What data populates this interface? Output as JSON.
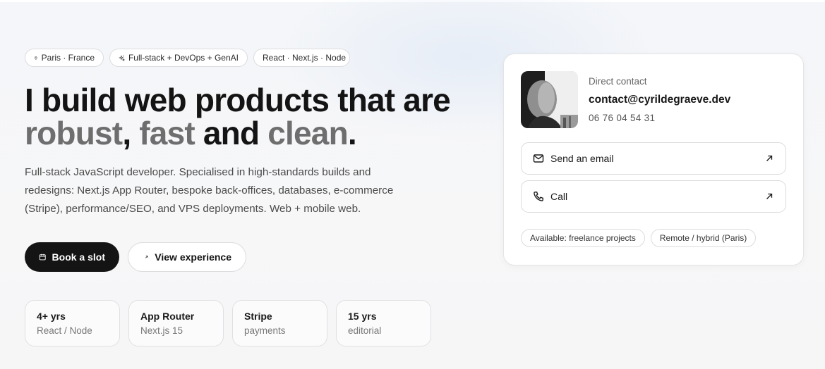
{
  "tags": [
    {
      "icon": "location-pin-icon",
      "label": "Paris · France"
    },
    {
      "icon": "sparkles-icon",
      "label": "Full-stack + DevOps + GenAI"
    },
    {
      "icon": "",
      "label": "React · Next.js · Node"
    }
  ],
  "hero": {
    "line1": "I build web products that are",
    "word_robust": "robust",
    "comma": ",",
    "word_fast": "fast",
    "and": "and",
    "word_clean": "clean",
    "period": ".",
    "intro": "Full-stack JavaScript developer. Specialised in high-standards builds and redesigns: Next.js App Router, bespoke back-offices, databases, e-commerce (Stripe), performance/SEO, and VPS deployments. Web + mobile web."
  },
  "cta": {
    "primary_label": "Book a slot",
    "secondary_label": "View experience"
  },
  "stats": [
    {
      "value": "4+ yrs",
      "sub": "React / Node"
    },
    {
      "value": "App Router",
      "sub": "Next.js 15"
    },
    {
      "value": "Stripe",
      "sub": "payments"
    },
    {
      "value": "15 yrs",
      "sub": "editorial"
    }
  ],
  "contact": {
    "label": "Direct contact",
    "email": "contact@cyrildegraeve.dev",
    "phone": "06 76 04 54 31",
    "email_action": "Send an email",
    "call_action": "Call",
    "chips": [
      "Available: freelance projects",
      "Remote / hybrid (Paris)"
    ]
  },
  "colors": {
    "text": "#141414",
    "muted_word": "#6e6e6e",
    "primary_button": "#141414",
    "background": "#f6f6f7"
  }
}
